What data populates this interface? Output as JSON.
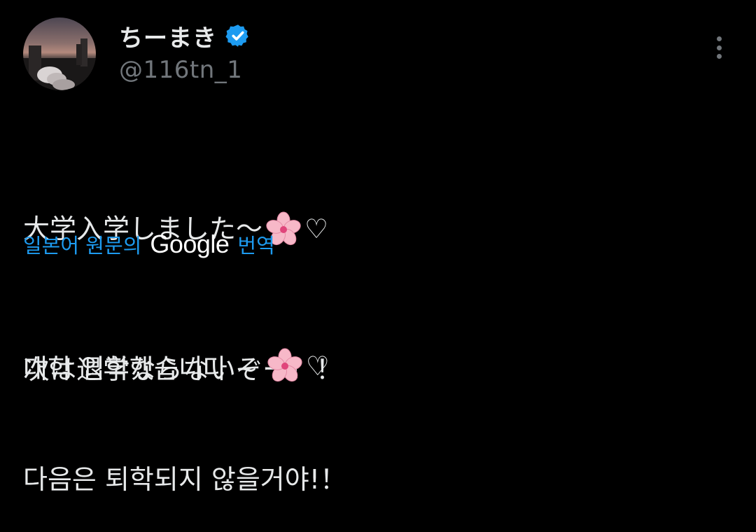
{
  "author": {
    "display_name": "ちーまき",
    "handle": "@116tn_1",
    "verified": true
  },
  "tweet": {
    "line1_text": "大学入学しました〜",
    "line1_heart": "♡",
    "line2": "次は退学ならないぞー！！"
  },
  "translation": {
    "source_label": "일본어 원문의",
    "provider": "Google",
    "action": "번역",
    "line1_text": "대학 입학했습니다 ~",
    "line1_heart": "♡",
    "line2": "다음은 퇴학되지 않을거야!！"
  },
  "icons": {
    "verified": "verified-badge-icon",
    "more": "more-vertical-icon",
    "flower": "cherry-blossom-icon",
    "heart": "white-heart-icon"
  },
  "colors": {
    "background": "#000000",
    "text_primary": "#e7e9ea",
    "text_secondary": "#71767b",
    "accent": "#1d9bf0",
    "blossom": "#f7b8c8"
  }
}
